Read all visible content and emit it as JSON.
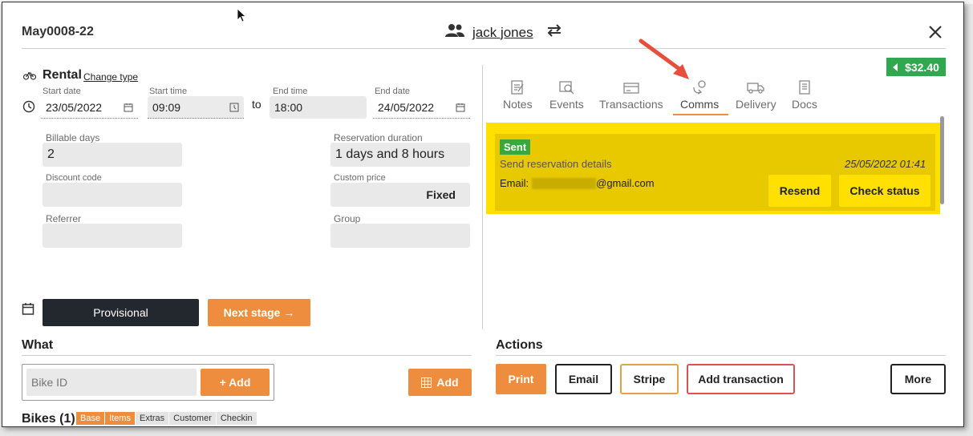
{
  "header": {
    "reservation_ref": "May0008-22",
    "customer_name": "jack jones"
  },
  "rental": {
    "title": "Rental",
    "change_type": "Change type",
    "start_date_label": "Start date",
    "start_date": "23/05/2022",
    "start_time_label": "Start time",
    "start_time": "09:09",
    "to_label": "to",
    "end_time_label": "End time",
    "end_time": "18:00",
    "end_date_label": "End date",
    "end_date": "24/05/2022",
    "billable_days_label": "Billable days",
    "billable_days": "2",
    "reservation_duration_label": "Reservation duration",
    "reservation_duration": "1 days and 8 hours",
    "discount_code_label": "Discount code",
    "discount_code": "",
    "custom_price_label": "Custom price",
    "custom_price_mode": "Fixed",
    "referrer_label": "Referrer",
    "referrer": "",
    "group_label": "Group",
    "group": ""
  },
  "stage": {
    "current": "Provisional",
    "next_label": "Next stage →"
  },
  "balance": "$32.40",
  "tabs": [
    {
      "label": "Notes"
    },
    {
      "label": "Events"
    },
    {
      "label": "Transactions"
    },
    {
      "label": "Comms",
      "active": true
    },
    {
      "label": "Delivery"
    },
    {
      "label": "Docs"
    }
  ],
  "comms": {
    "status": "Sent",
    "description": "Send reservation details",
    "date": "25/05/2022 01:41",
    "email_label": "Email:",
    "email_domain": "@gmail.com",
    "resend": "Resend",
    "check_status": "Check status"
  },
  "what": {
    "title": "What",
    "bike_id_placeholder": "Bike ID",
    "add_label": "+ Add",
    "grid_add_label": "Add",
    "bikes_title": "Bikes (1)",
    "bike_tags": [
      "Base",
      "Items",
      "Extras",
      "Customer",
      "Checkin"
    ]
  },
  "actions": {
    "title": "Actions",
    "print": "Print",
    "email": "Email",
    "stripe": "Stripe",
    "add_transaction": "Add transaction",
    "more": "More"
  },
  "colors": {
    "accent_orange": "#ef8d3f",
    "highlight_yellow": "#ffe000",
    "success_green": "#2fa84f",
    "stripe_border": "#e3a24a",
    "add_txn_border": "#d9534f"
  }
}
